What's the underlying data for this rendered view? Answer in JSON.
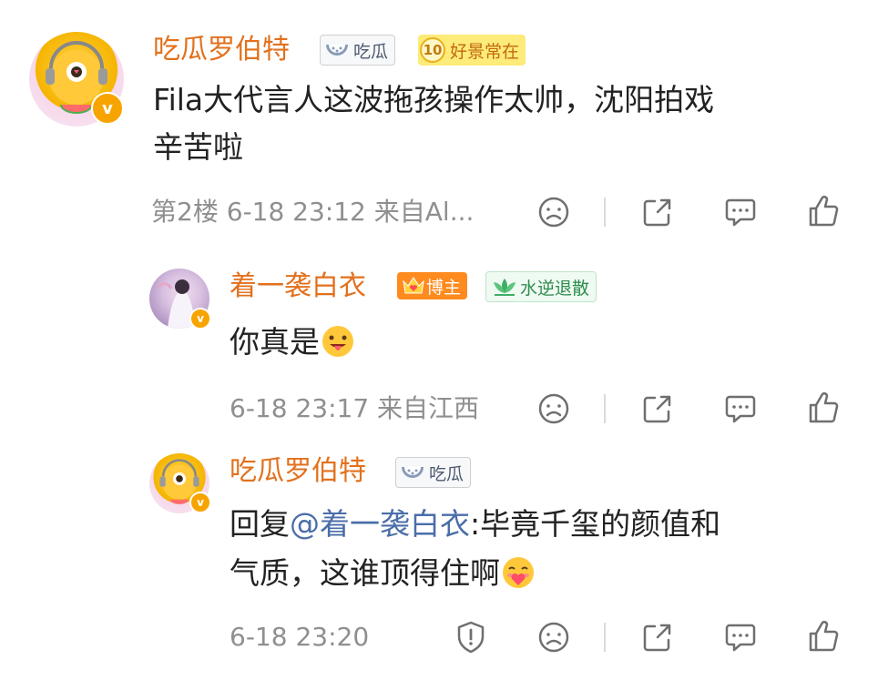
{
  "comment": {
    "username": "吃瓜罗伯特",
    "badges": {
      "melon": "吃瓜",
      "level_num": "10",
      "level_text": "好景常在"
    },
    "text_line1": "Fila大代言人这波拖孩操作太帅，沈阳拍戏",
    "text_line2": "辛苦啦",
    "meta": "第2楼  6-18 23:12  来自Al...",
    "avatar_badge": "v"
  },
  "reply1": {
    "username": "着一袭白衣",
    "badges": {
      "host": "博主",
      "green": "水逆退散"
    },
    "text": "你真是",
    "emoji": "tongue-emoji",
    "meta": "6-18 23:17  来自江西"
  },
  "reply2": {
    "username": "吃瓜罗伯特",
    "badges": {
      "melon": "吃瓜"
    },
    "text_prefix": "回复",
    "mention": "@着一袭白衣",
    "text_rest_line1": ":毕竟千玺的颜值和",
    "text_line2": "气质，这谁顶得住啊",
    "emoji": "love-emoji",
    "meta": "6-18 23:20"
  },
  "icons": {
    "dislike": "frown-face-icon",
    "share": "share-icon",
    "comment": "comment-icon",
    "like": "thumbs-up-icon",
    "report": "report-shield-icon"
  },
  "colors": {
    "username": "#e2711d",
    "text": "#222222",
    "meta": "#8f8f8f",
    "mention": "#4a6ea8",
    "icon": "#6f6f6f"
  }
}
